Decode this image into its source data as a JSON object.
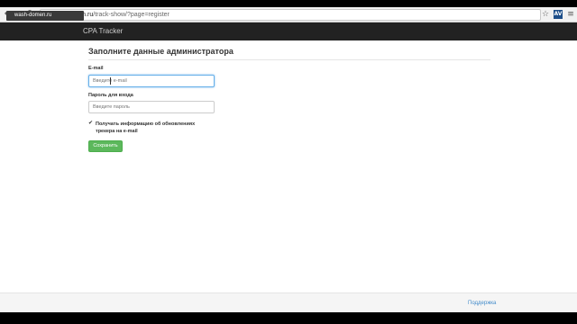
{
  "browser": {
    "url_host": "wash-domen.ru",
    "url_rest": "/track-show/?page=register",
    "overlay_text": "wash-domen.ru",
    "ext_icon": "AV"
  },
  "navbar": {
    "brand": "CPA Tracker"
  },
  "form": {
    "title": "Заполните данные администратора",
    "email_label": "E-mail",
    "email_placeholder": "Введите e-mail",
    "password_label": "Пароль для входа",
    "password_placeholder": "Введите пароль",
    "subscribe_checked": true,
    "subscribe_label": "Получать информацию об обновлениях трекера на e-mail",
    "save_label": "Сохранить"
  },
  "footer": {
    "support_link": "Поддержка"
  },
  "colors": {
    "navbar_bg": "#222222",
    "button_success": "#5cb85c",
    "link": "#428bca"
  }
}
